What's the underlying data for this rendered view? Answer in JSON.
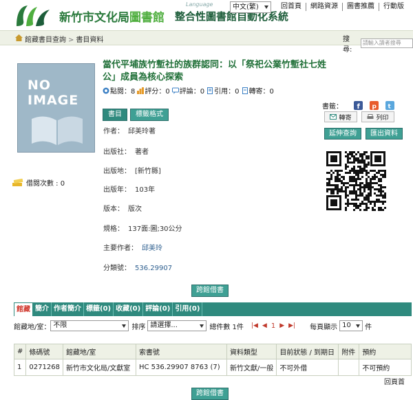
{
  "header": {
    "lib_name_main": "新竹市文化局",
    "lib_name_accent": "圖書館",
    "system_name": "整合性圖書館自動化系統",
    "language_label": "Language",
    "language_value": "中文(繁)",
    "top_links": [
      "回首頁",
      "網路資源",
      "圖書推薦",
      "行動版"
    ]
  },
  "breadcrumb": {
    "items": [
      "館藏書目查詢",
      "書目資料"
    ],
    "separator": ">",
    "search_label": "搜尋:",
    "search_placeholder": "請輸入讀者搜尋"
  },
  "cover": {
    "line1": "NO",
    "line2": "IMAGE"
  },
  "loan": {
    "label": "借閱次數 : 0"
  },
  "book": {
    "title": "當代平埔族竹塹社的族群認同：以「祭祀公業竹塹社七姓公」成員為核心探索",
    "stats": [
      {
        "icon": "eye-icon",
        "text": "點閱：8"
      },
      {
        "icon": "rating-icon",
        "text": "評分：0"
      },
      {
        "icon": "comment-icon",
        "text": "評論：0"
      },
      {
        "icon": "cite-icon",
        "text": "引用：0"
      },
      {
        "icon": "forward-icon",
        "text": "轉寄：0"
      }
    ],
    "tab_buttons": [
      "書目",
      "標籤格式"
    ],
    "fields": [
      {
        "label": "作者：",
        "value": "邱美玲著",
        "link": false
      },
      {
        "label": "出版社：",
        "value": "著者",
        "link": false
      },
      {
        "label": "出版地：",
        "value": "[新竹縣]",
        "link": false
      },
      {
        "label": "出版年：",
        "value": "103年",
        "link": false
      },
      {
        "label": "版本：",
        "value": "版次",
        "link": false
      },
      {
        "label": "規格：",
        "value": "137面:圖;30公分",
        "link": false
      },
      {
        "label": "主要作者：",
        "value": "邱美玲",
        "link": true
      },
      {
        "label": "分類號：",
        "value": "536.29907",
        "link": true
      }
    ]
  },
  "share": {
    "label": "書籤：",
    "send_label": "轉寄",
    "print_label": "列印",
    "extend_search": "延伸查詢",
    "export_data": "匯出資料"
  },
  "ill_button": "跨館借書",
  "holdings": {
    "tabs": [
      "館藏",
      "簡介",
      "作者簡介",
      "標籤(0)",
      "收藏(0)",
      "評論(0)",
      "引用(0)"
    ],
    "filter_label": "館藏地/室：",
    "filter_value": "不限",
    "sort_label": "排序",
    "sort_value": "請選擇...",
    "total_label": "總件數 1件",
    "page_current": "1",
    "page_size_label": "每頁顯示",
    "page_size_value": "10",
    "page_size_unit": "件",
    "columns": [
      "#",
      "條碼號",
      "館藏地/室",
      "索書號",
      "資料類型",
      "目前狀態 / 到期日",
      "附件",
      "預約"
    ],
    "rows": [
      [
        "1",
        "0271268",
        "新竹市文化局/文獻室",
        "HC 536.29907 8763 (7)",
        "新竹文獻/一般",
        "不可外借",
        "",
        "不可預約"
      ]
    ],
    "back_top": "回頁首"
  },
  "colors": {
    "brand_green": "#2a7a3c",
    "teal": "#2f8a7e",
    "accent_red": "#d03a2f"
  }
}
